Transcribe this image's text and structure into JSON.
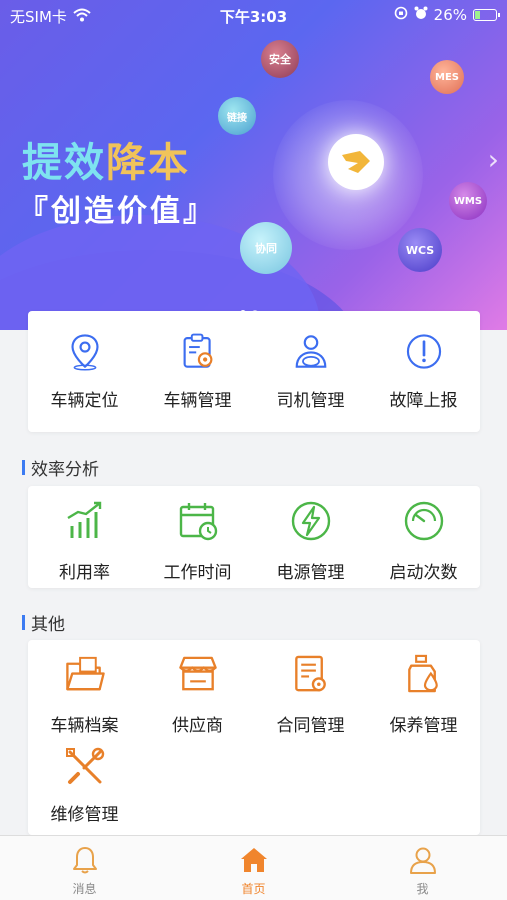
{
  "status_bar": {
    "carrier": "无SIM卡",
    "time": "下午3:03",
    "battery": "26%",
    "battery_level": 0.26
  },
  "banner": {
    "slogan_part1": "提效",
    "slogan_part2": "降本",
    "slogan_line2": "『创造价值』",
    "orbs": [
      "安全",
      "MES",
      "链接",
      "WMS",
      "协同",
      "WCS"
    ],
    "chevron": "›"
  },
  "quick_actions": [
    {
      "label": "车辆定位",
      "icon": "location-pin-icon"
    },
    {
      "label": "车辆管理",
      "icon": "clipboard-gear-icon"
    },
    {
      "label": "司机管理",
      "icon": "driver-icon"
    },
    {
      "label": "故障上报",
      "icon": "alert-circle-icon"
    }
  ],
  "efficiency": {
    "title": "效率分析",
    "items": [
      {
        "label": "利用率",
        "icon": "bar-trend-icon"
      },
      {
        "label": "工作时间",
        "icon": "calendar-clock-icon"
      },
      {
        "label": "电源管理",
        "icon": "lightning-icon"
      },
      {
        "label": "启动次数",
        "icon": "gauge-icon"
      }
    ]
  },
  "other": {
    "title": "其他",
    "items": [
      {
        "label": "车辆档案",
        "icon": "folder-icon"
      },
      {
        "label": "供应商",
        "icon": "store-icon"
      },
      {
        "label": "合同管理",
        "icon": "contract-icon"
      },
      {
        "label": "保养管理",
        "icon": "oil-bottle-icon"
      },
      {
        "label": "维修管理",
        "icon": "tools-icon"
      }
    ]
  },
  "tabs": [
    {
      "label": "消息",
      "icon": "bell-icon"
    },
    {
      "label": "首页",
      "icon": "home-icon"
    },
    {
      "label": "我",
      "icon": "person-icon"
    }
  ],
  "colors": {
    "blue_icon": "#3c6df0",
    "green_icon": "#4cb648",
    "orange_icon": "#e8802a",
    "active_tab": "#f0852d"
  }
}
